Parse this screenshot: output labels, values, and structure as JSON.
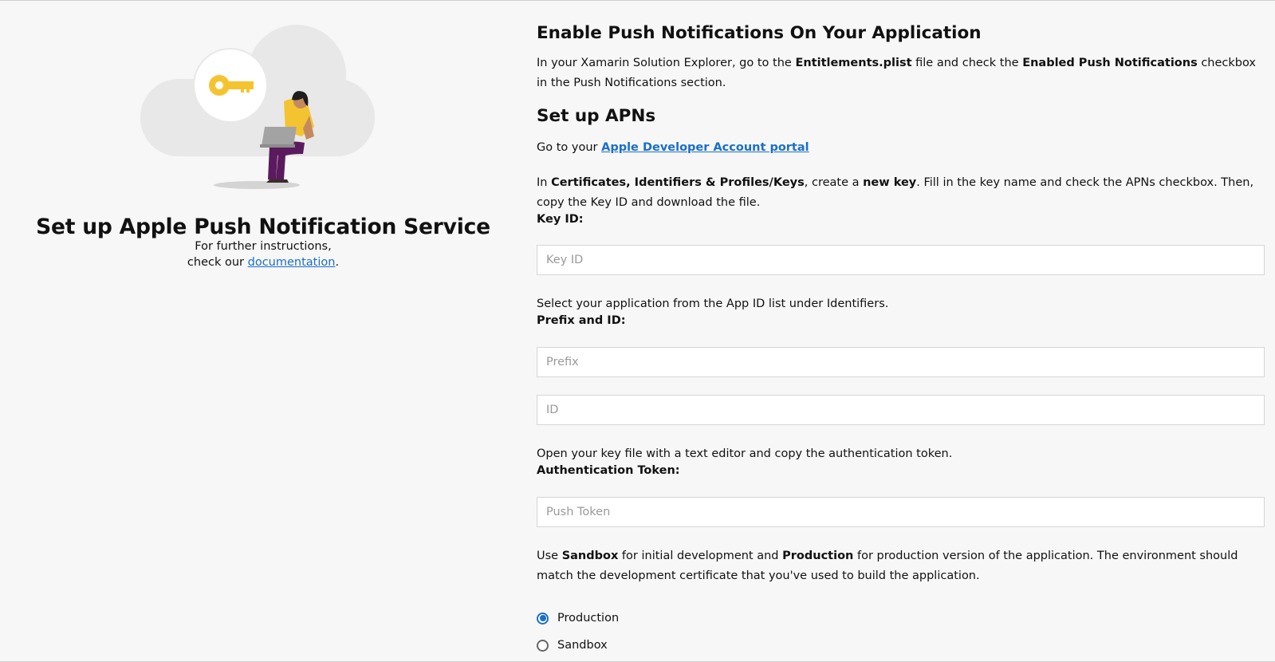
{
  "left": {
    "title": "Set up Apple Push Notification Service",
    "sub_line1": "For further instructions,",
    "sub_line2_prefix": "check our ",
    "doc_link": "documentation",
    "sub_line2_suffix": "."
  },
  "enable_section": {
    "heading": "Enable Push Notifications On Your Application",
    "text_1": "In your Xamarin Solution Explorer, go to the ",
    "bold_1": "Entitlements.plist",
    "text_2": " file and check the ",
    "bold_2": "Enabled Push Notifications",
    "text_3": " checkbox in the Push Notifications section."
  },
  "apns_section": {
    "heading": "Set up APNs",
    "goto_prefix": "Go to your ",
    "portal_link": "Apple Developer Account portal",
    "certs_text_1": "In ",
    "certs_bold_1": "Certificates, Identifiers & Profiles/Keys",
    "certs_text_2": ", create a ",
    "certs_bold_2": "new key",
    "certs_text_3": ". Fill in the key name and check the APNs checkbox. Then, copy the Key ID and download the file.",
    "key_id_label": "Key ID:",
    "key_id_placeholder": "Key ID",
    "select_app_text": "Select your application from the App ID list under Identifiers.",
    "prefix_id_label": "Prefix and ID:",
    "prefix_placeholder": "Prefix",
    "id_placeholder": "ID",
    "open_key_text": "Open your key file with a text editor and copy the authentication token.",
    "auth_token_label": "Authentication Token:",
    "push_token_placeholder": "Push Token",
    "env_text_1": "Use ",
    "env_bold_1": "Sandbox",
    "env_text_2": " for initial development and ",
    "env_bold_2": "Production",
    "env_text_3": " for production version of the application. The environment should match the development certificate that you've used to build the application.",
    "radio_production": "Production",
    "radio_sandbox": "Sandbox",
    "selected_environment": "Production"
  },
  "colors": {
    "accent": "#1a6fc9",
    "background": "#f7f7f7",
    "illustration_yellow": "#f4c430",
    "illustration_purple": "#5b1a5e",
    "cloud": "#e8e8e8"
  },
  "icons": [
    "key-icon",
    "cloud-illustration",
    "person-with-laptop-illustration"
  ]
}
